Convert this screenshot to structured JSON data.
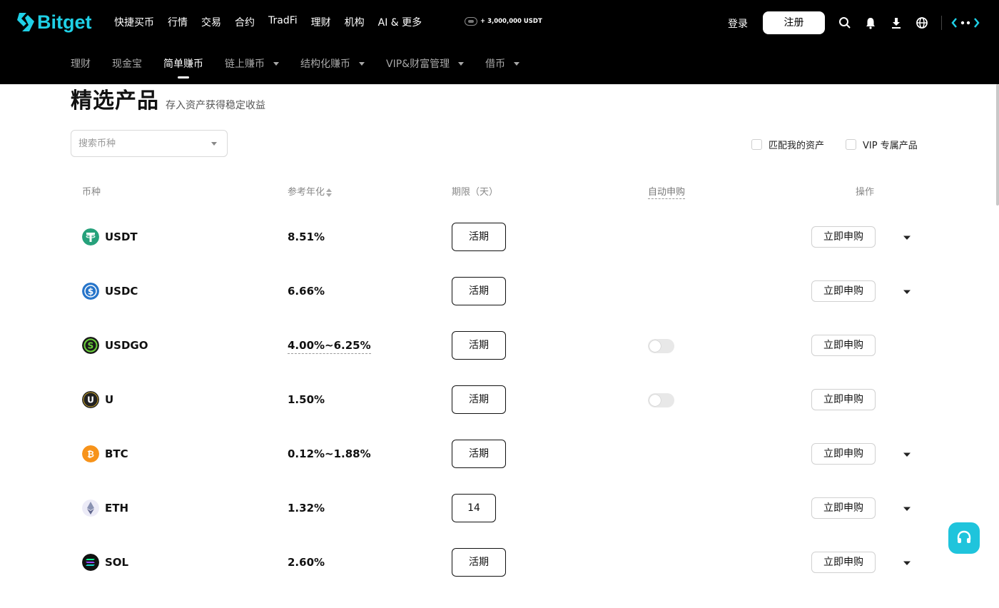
{
  "brand": {
    "name": "Bitget",
    "color": "#1fd0e6"
  },
  "topnav": {
    "items": [
      "快捷买币",
      "行情",
      "交易",
      "合约",
      "TradFi",
      "理财",
      "机构",
      "AI & 更多"
    ],
    "promo": "+ 3,000,000 USDT",
    "login": "登录",
    "register": "注册",
    "icons": [
      "search-icon",
      "bell-icon",
      "download-icon",
      "globe-icon",
      "more-icon"
    ]
  },
  "subnav": {
    "items": [
      {
        "label": "理财",
        "dropdown": false,
        "active": false
      },
      {
        "label": "现金宝",
        "dropdown": false,
        "active": false
      },
      {
        "label": "简单赚币",
        "dropdown": false,
        "active": true
      },
      {
        "label": "链上赚币",
        "dropdown": true,
        "active": false
      },
      {
        "label": "结构化赚币",
        "dropdown": true,
        "active": false
      },
      {
        "label": "VIP&财富管理",
        "dropdown": true,
        "active": false
      },
      {
        "label": "借币",
        "dropdown": true,
        "active": false
      }
    ]
  },
  "page": {
    "title": "精选产品",
    "subtitle": "存入资产获得稳定收益",
    "search_placeholder": "搜索币种",
    "filters": {
      "match_assets": "匹配我的资产",
      "vip_only": "VIP 专属产品"
    }
  },
  "table": {
    "headers": {
      "coin": "币种",
      "apr": "参考年化",
      "term": "期限（天）",
      "auto": "自动申购",
      "action": "操作"
    },
    "rows": [
      {
        "coin": "USDT",
        "apr": "8.51%",
        "term": "活期",
        "auto_toggle": false,
        "button": "立即申购",
        "expandable": true,
        "icon_color": "#26a17b"
      },
      {
        "coin": "USDC",
        "apr": "6.66%",
        "term": "活期",
        "auto_toggle": false,
        "button": "立即申购",
        "expandable": true,
        "icon_color": "#2775ca"
      },
      {
        "coin": "USDGO",
        "apr": "4.00%~6.25%",
        "term": "活期",
        "auto_toggle": true,
        "button": "立即申购",
        "expandable": false,
        "icon_color": "#1a1a1a"
      },
      {
        "coin": "U",
        "apr": "1.50%",
        "term": "活期",
        "auto_toggle": true,
        "button": "立即申购",
        "expandable": false,
        "icon_color": "#222222"
      },
      {
        "coin": "BTC",
        "apr": "0.12%~1.88%",
        "term": "活期",
        "auto_toggle": false,
        "button": "立即申购",
        "expandable": true,
        "icon_color": "#f7931a"
      },
      {
        "coin": "ETH",
        "apr": "1.32%",
        "term": "14",
        "auto_toggle": false,
        "button": "立即申购",
        "expandable": true,
        "icon_color": "#ecebf7"
      },
      {
        "coin": "SOL",
        "apr": "2.60%",
        "term": "活期",
        "auto_toggle": false,
        "button": "立即申购",
        "expandable": true,
        "icon_color": "#111111"
      }
    ]
  },
  "support_icon": "headset-icon",
  "accent": "#1fc4dc"
}
